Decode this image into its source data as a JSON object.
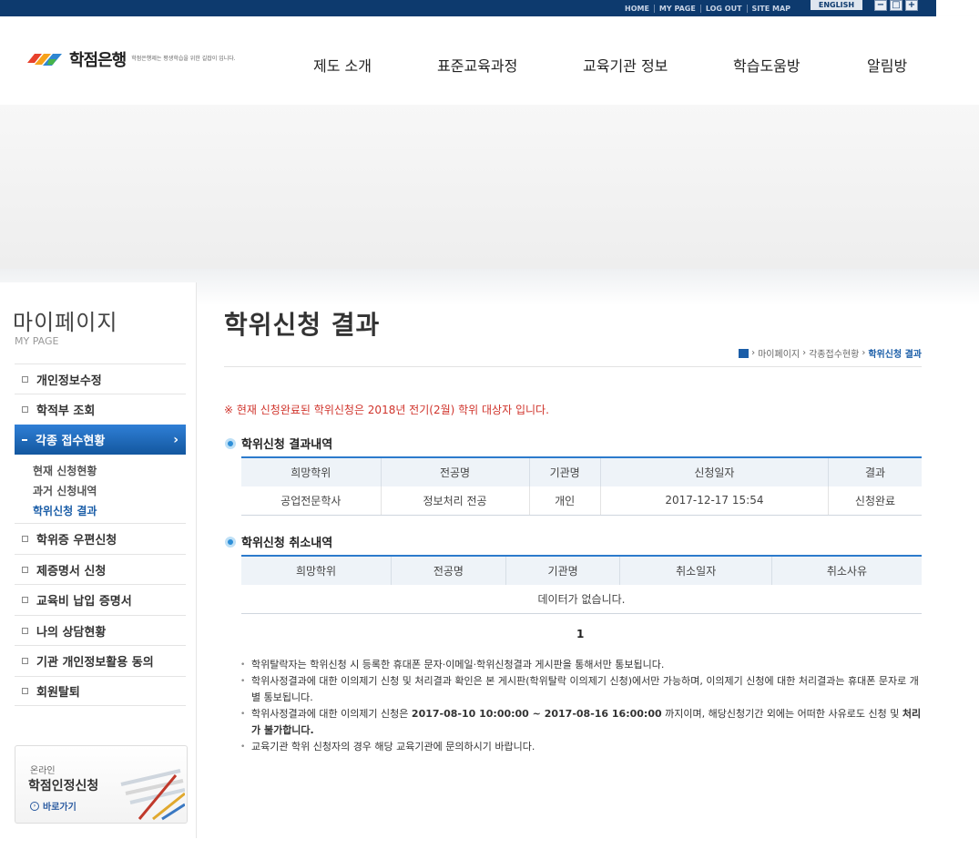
{
  "util_links": [
    "HOME",
    "MY PAGE",
    "LOG OUT",
    "SITE MAP"
  ],
  "english_label": "ENGLISH",
  "zoom": {
    "out": "−",
    "reset": "□",
    "in": "+"
  },
  "logo": {
    "name": "학점은행",
    "tagline": "학점은행제는 평생학습을 위한 길잡이 입니다."
  },
  "gnb": [
    "제도 소개",
    "표준교육과정",
    "교육기관 정보",
    "학습도움방",
    "알림방"
  ],
  "lnb": {
    "title": "마이페이지",
    "subtitle": "MY PAGE",
    "items": [
      "개인정보수정",
      "학적부 조회",
      "각종 접수현황",
      "학위증 우편신청",
      "제증명서 신청",
      "교육비 납입 증명서",
      "나의 상담현황",
      "기관 개인정보활용 동의",
      "회원탈퇴"
    ],
    "sub_items": [
      "현재 신청현황",
      "과거 신청내역",
      "학위신청 결과"
    ],
    "banner": {
      "line1": "온라인",
      "line2": "학점인정신청",
      "link": "바로가기"
    }
  },
  "page": {
    "title": "학위신청 결과",
    "breadcrumb": [
      "마이페이지",
      "각종접수현황",
      "학위신청 결과"
    ],
    "notice": "※ 현재 신청완료된 학위신청은 2018년 전기(2월) 학위 대상자 입니다."
  },
  "result_section": {
    "title": "학위신청 결과내역",
    "headers": [
      "희망학위",
      "전공명",
      "기관명",
      "신청일자",
      "결과"
    ],
    "rows": [
      [
        "공업전문학사",
        "정보처리 전공",
        "개인",
        "2017-12-17 15:54",
        "신청완료"
      ]
    ]
  },
  "cancel_section": {
    "title": "학위신청 취소내역",
    "headers": [
      "희망학위",
      "전공명",
      "기관명",
      "취소일자",
      "취소사유"
    ],
    "empty": "데이터가 없습니다."
  },
  "pager": "1",
  "notes": {
    "n1": "학위탈락자는 학위신청 시 등록한 휴대폰 문자·이메일·학위신청결과 게시판을 통해서만 통보됩니다.",
    "n2": "학위사정결과에 대한 이의제기 신청 및 처리결과 확인은 본 게시판(학위탈락 이의제기 신청)에서만 가능하며, 이의제기 신청에 대한 처리결과는 휴대폰 문자로 개별 통보됩니다.",
    "n3_pre": "학위사정결과에 대한 이의제기 신청은",
    "n3_bold": "2017-08-10 10:00:00 ~ 2017-08-16 16:00:00",
    "n3_mid": "까지이며, 해당신청기간 외에는 어떠한 사유로도 신청 및",
    "n3_bold2": "처리가 불가합니다.",
    "n4": "교육기관 학위 신청자의 경우 해당 교육기관에 문의하시기 바랍니다."
  }
}
